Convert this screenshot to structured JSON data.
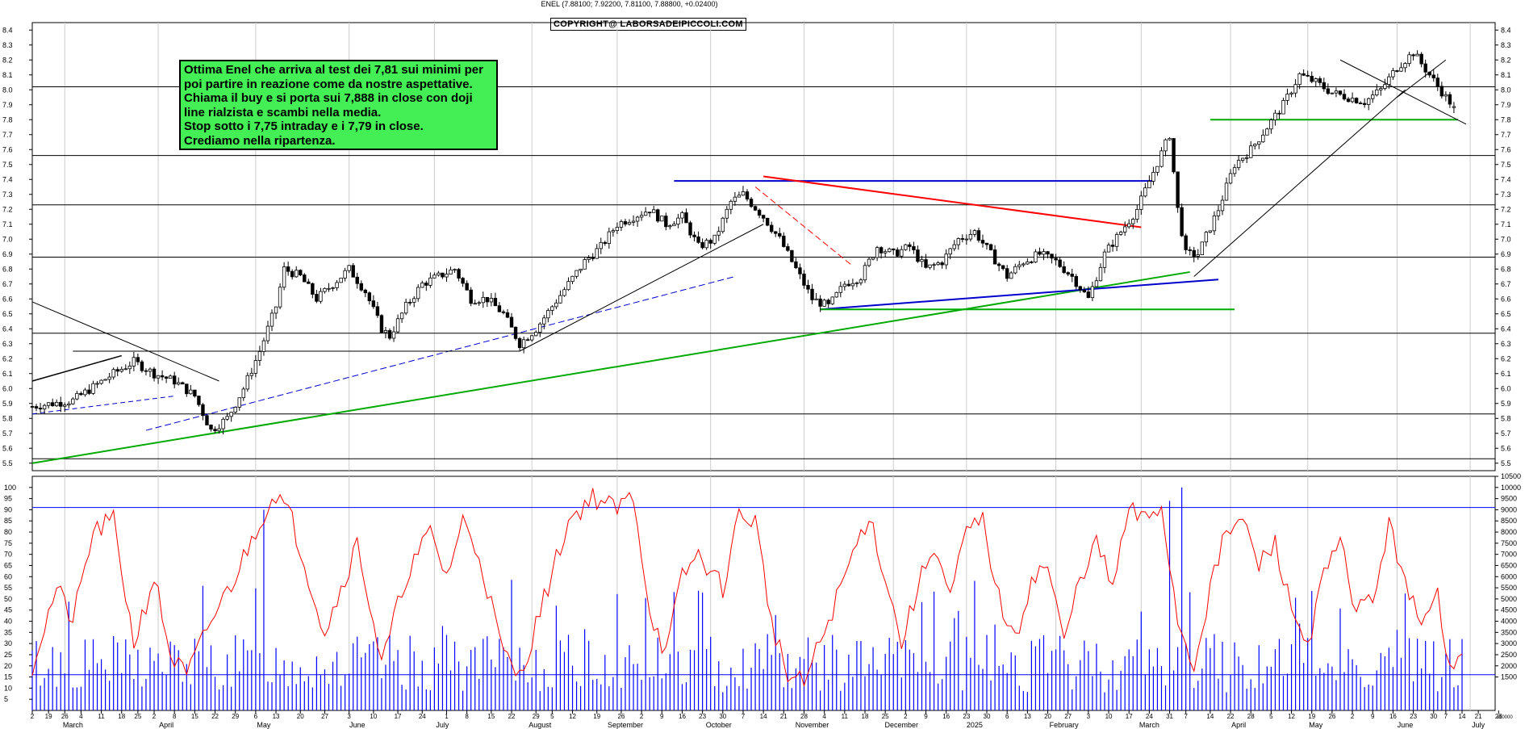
{
  "header": {
    "title": "ENEL (7.88100; 7.92200, 7.81100, 7.88800, +0.02400)",
    "copyright": "COPYRIGHT@ LABORSADEIPICCOLI.COM"
  },
  "annotation": {
    "lines": [
      "Ottima Enel che arriva al test dei 7,81 sui minimi per",
      "poi partire in reazione come da nostre aspettative.",
      "Chiama il buy e si porta sui 7,888 in close con doji",
      "line rialzista e scambi nella media.",
      "Stop sotto i 7,75 intraday e i 7,79 in close.",
      "Crediamo nella ripartenza."
    ]
  },
  "colors": {
    "candle_body": "#000000",
    "oscillator": "#ff0000",
    "volume": "#0000ff",
    "support_line": "#00aa00",
    "trend_blue": "#0000cc",
    "trend_red": "#ff0000",
    "annotation_bg": "#44ee55"
  },
  "chart_data": [
    {
      "type": "candlestick",
      "title": "ENEL daily",
      "ylim": [
        5.45,
        8.45
      ],
      "y_ticks": [
        5.5,
        5.6,
        5.7,
        5.8,
        5.9,
        6.0,
        6.1,
        6.2,
        6.3,
        6.4,
        6.5,
        6.6,
        6.7,
        6.8,
        6.9,
        7.0,
        7.1,
        7.2,
        7.3,
        7.4,
        7.5,
        7.6,
        7.7,
        7.8,
        7.9,
        8.0,
        8.1,
        8.2,
        8.3,
        8.4
      ],
      "y_tick_labels": [
        "5.5",
        "5.6",
        "5.7",
        "5.8",
        "5.9",
        "6.0",
        "6.1",
        "6.2",
        "6.3",
        "6.4",
        "6.5",
        "6.6",
        "6.7",
        "6.8",
        "6.9",
        "7.0",
        "7.1",
        "7.2",
        "7.3",
        "7.4",
        "7.5",
        "7.6",
        "7.7",
        "7.8",
        "7.9",
        "8.0",
        "8.1",
        "8.2",
        "8.3",
        "8.4"
      ],
      "horizontal_levels": [
        5.53,
        5.83,
        6.37,
        6.88,
        7.23,
        7.56,
        8.02
      ],
      "close_path": [
        {
          "d": 0,
          "v": 5.88
        },
        {
          "d": 10,
          "v": 5.92
        },
        {
          "d": 20,
          "v": 6.1
        },
        {
          "d": 25,
          "v": 6.18
        },
        {
          "d": 30,
          "v": 6.1
        },
        {
          "d": 35,
          "v": 6.05
        },
        {
          "d": 40,
          "v": 5.95
        },
        {
          "d": 44,
          "v": 5.72
        },
        {
          "d": 48,
          "v": 5.8
        },
        {
          "d": 52,
          "v": 6.0
        },
        {
          "d": 56,
          "v": 6.25
        },
        {
          "d": 60,
          "v": 6.55
        },
        {
          "d": 62,
          "v": 6.8
        },
        {
          "d": 66,
          "v": 6.75
        },
        {
          "d": 70,
          "v": 6.6
        },
        {
          "d": 74,
          "v": 6.7
        },
        {
          "d": 78,
          "v": 6.8
        },
        {
          "d": 82,
          "v": 6.65
        },
        {
          "d": 86,
          "v": 6.4
        },
        {
          "d": 88,
          "v": 6.35
        },
        {
          "d": 92,
          "v": 6.55
        },
        {
          "d": 96,
          "v": 6.7
        },
        {
          "d": 100,
          "v": 6.75
        },
        {
          "d": 104,
          "v": 6.8
        },
        {
          "d": 108,
          "v": 6.6
        },
        {
          "d": 112,
          "v": 6.6
        },
        {
          "d": 116,
          "v": 6.5
        },
        {
          "d": 120,
          "v": 6.3
        },
        {
          "d": 124,
          "v": 6.4
        },
        {
          "d": 128,
          "v": 6.55
        },
        {
          "d": 132,
          "v": 6.7
        },
        {
          "d": 136,
          "v": 6.85
        },
        {
          "d": 140,
          "v": 6.95
        },
        {
          "d": 144,
          "v": 7.1
        },
        {
          "d": 148,
          "v": 7.15
        },
        {
          "d": 152,
          "v": 7.2
        },
        {
          "d": 156,
          "v": 7.1
        },
        {
          "d": 160,
          "v": 7.15
        },
        {
          "d": 164,
          "v": 6.95
        },
        {
          "d": 168,
          "v": 7.0
        },
        {
          "d": 172,
          "v": 7.25
        },
        {
          "d": 175,
          "v": 7.3
        },
        {
          "d": 180,
          "v": 7.15
        },
        {
          "d": 184,
          "v": 7.0
        },
        {
          "d": 188,
          "v": 6.8
        },
        {
          "d": 192,
          "v": 6.6
        },
        {
          "d": 196,
          "v": 6.55
        },
        {
          "d": 200,
          "v": 6.7
        },
        {
          "d": 204,
          "v": 6.75
        },
        {
          "d": 208,
          "v": 6.95
        },
        {
          "d": 212,
          "v": 6.9
        },
        {
          "d": 216,
          "v": 6.95
        },
        {
          "d": 220,
          "v": 6.8
        },
        {
          "d": 224,
          "v": 6.85
        },
        {
          "d": 228,
          "v": 7.0
        },
        {
          "d": 232,
          "v": 7.05
        },
        {
          "d": 236,
          "v": 6.9
        },
        {
          "d": 240,
          "v": 6.75
        },
        {
          "d": 244,
          "v": 6.85
        },
        {
          "d": 248,
          "v": 6.9
        },
        {
          "d": 252,
          "v": 6.85
        },
        {
          "d": 256,
          "v": 6.75
        },
        {
          "d": 260,
          "v": 6.6
        },
        {
          "d": 264,
          "v": 6.9
        },
        {
          "d": 268,
          "v": 7.05
        },
        {
          "d": 272,
          "v": 7.2
        },
        {
          "d": 276,
          "v": 7.45
        },
        {
          "d": 280,
          "v": 7.7
        },
        {
          "d": 282,
          "v": 7.2
        },
        {
          "d": 284,
          "v": 6.9
        },
        {
          "d": 287,
          "v": 6.9
        },
        {
          "d": 292,
          "v": 7.2
        },
        {
          "d": 296,
          "v": 7.5
        },
        {
          "d": 300,
          "v": 7.6
        },
        {
          "d": 304,
          "v": 7.75
        },
        {
          "d": 308,
          "v": 7.9
        },
        {
          "d": 312,
          "v": 8.1
        },
        {
          "d": 316,
          "v": 8.05
        },
        {
          "d": 320,
          "v": 7.98
        },
        {
          "d": 324,
          "v": 7.95
        },
        {
          "d": 328,
          "v": 7.92
        },
        {
          "d": 332,
          "v": 8.0
        },
        {
          "d": 336,
          "v": 8.15
        },
        {
          "d": 340,
          "v": 8.25
        },
        {
          "d": 344,
          "v": 8.1
        },
        {
          "d": 348,
          "v": 7.95
        },
        {
          "d": 350,
          "v": 7.888
        }
      ],
      "trendlines": [
        {
          "color": "support_line",
          "from": [
            0,
            5.5
          ],
          "to": [
            285,
            6.78
          ]
        },
        {
          "color": "trend_blue",
          "from": [
            194,
            6.53
          ],
          "to": [
            292,
            6.73
          ]
        },
        {
          "color": "trend_blue",
          "from": [
            158,
            7.39
          ],
          "to": [
            276,
            7.39
          ]
        },
        {
          "color": "trend_red",
          "from": [
            180,
            7.42
          ],
          "to": [
            273,
            7.08
          ]
        },
        {
          "color": "support_line",
          "from": [
            290,
            7.8
          ],
          "to": [
            351,
            7.8
          ]
        },
        {
          "color": "support_line",
          "from": [
            194,
            6.53
          ],
          "to": [
            296,
            6.53
          ]
        }
      ]
    },
    {
      "type": "line",
      "ylim": [
        0,
        105
      ],
      "y_ticks": [
        5,
        10,
        15,
        20,
        25,
        30,
        35,
        40,
        45,
        50,
        55,
        60,
        65,
        70,
        75,
        80,
        85,
        90,
        95,
        100
      ],
      "y_tick_labels": [
        "5",
        "10",
        "15",
        "20",
        "25",
        "30",
        "35",
        "40",
        "45",
        "50",
        "55",
        "60",
        "65",
        "70",
        "75",
        "80",
        "85",
        "90",
        "95",
        "100"
      ],
      "levels": [
        16,
        91
      ],
      "oscillator_path": [
        {
          "d": 0,
          "v": 20
        },
        {
          "d": 6,
          "v": 55
        },
        {
          "d": 10,
          "v": 40
        },
        {
          "d": 15,
          "v": 80
        },
        {
          "d": 20,
          "v": 85
        },
        {
          "d": 25,
          "v": 30
        },
        {
          "d": 30,
          "v": 60
        },
        {
          "d": 34,
          "v": 25
        },
        {
          "d": 38,
          "v": 15
        },
        {
          "d": 44,
          "v": 40
        },
        {
          "d": 50,
          "v": 60
        },
        {
          "d": 56,
          "v": 85
        },
        {
          "d": 60,
          "v": 98
        },
        {
          "d": 64,
          "v": 85
        },
        {
          "d": 68,
          "v": 60
        },
        {
          "d": 72,
          "v": 35
        },
        {
          "d": 76,
          "v": 55
        },
        {
          "d": 80,
          "v": 75
        },
        {
          "d": 84,
          "v": 40
        },
        {
          "d": 86,
          "v": 20
        },
        {
          "d": 92,
          "v": 60
        },
        {
          "d": 98,
          "v": 80
        },
        {
          "d": 102,
          "v": 60
        },
        {
          "d": 106,
          "v": 85
        },
        {
          "d": 110,
          "v": 70
        },
        {
          "d": 116,
          "v": 25
        },
        {
          "d": 120,
          "v": 15
        },
        {
          "d": 126,
          "v": 50
        },
        {
          "d": 132,
          "v": 85
        },
        {
          "d": 138,
          "v": 96
        },
        {
          "d": 144,
          "v": 90
        },
        {
          "d": 148,
          "v": 97
        },
        {
          "d": 152,
          "v": 45
        },
        {
          "d": 156,
          "v": 25
        },
        {
          "d": 160,
          "v": 60
        },
        {
          "d": 164,
          "v": 70
        },
        {
          "d": 170,
          "v": 55
        },
        {
          "d": 174,
          "v": 88
        },
        {
          "d": 178,
          "v": 85
        },
        {
          "d": 182,
          "v": 40
        },
        {
          "d": 186,
          "v": 15
        },
        {
          "d": 190,
          "v": 12
        },
        {
          "d": 196,
          "v": 40
        },
        {
          "d": 202,
          "v": 70
        },
        {
          "d": 206,
          "v": 88
        },
        {
          "d": 210,
          "v": 60
        },
        {
          "d": 214,
          "v": 30
        },
        {
          "d": 218,
          "v": 55
        },
        {
          "d": 222,
          "v": 75
        },
        {
          "d": 226,
          "v": 50
        },
        {
          "d": 230,
          "v": 80
        },
        {
          "d": 234,
          "v": 85
        },
        {
          "d": 238,
          "v": 50
        },
        {
          "d": 242,
          "v": 30
        },
        {
          "d": 246,
          "v": 60
        },
        {
          "d": 250,
          "v": 65
        },
        {
          "d": 254,
          "v": 30
        },
        {
          "d": 258,
          "v": 60
        },
        {
          "d": 262,
          "v": 75
        },
        {
          "d": 266,
          "v": 55
        },
        {
          "d": 270,
          "v": 90
        },
        {
          "d": 274,
          "v": 85
        },
        {
          "d": 278,
          "v": 92
        },
        {
          "d": 282,
          "v": 40
        },
        {
          "d": 286,
          "v": 20
        },
        {
          "d": 290,
          "v": 55
        },
        {
          "d": 294,
          "v": 80
        },
        {
          "d": 298,
          "v": 85
        },
        {
          "d": 302,
          "v": 65
        },
        {
          "d": 306,
          "v": 75
        },
        {
          "d": 310,
          "v": 45
        },
        {
          "d": 314,
          "v": 30
        },
        {
          "d": 318,
          "v": 60
        },
        {
          "d": 322,
          "v": 75
        },
        {
          "d": 326,
          "v": 45
        },
        {
          "d": 330,
          "v": 50
        },
        {
          "d": 334,
          "v": 82
        },
        {
          "d": 338,
          "v": 60
        },
        {
          "d": 342,
          "v": 35
        },
        {
          "d": 346,
          "v": 52
        },
        {
          "d": 348,
          "v": 30
        },
        {
          "d": 350,
          "v": 20
        },
        {
          "d": 352,
          "v": 30
        }
      ],
      "volume_ylim": [
        0,
        10500
      ],
      "volume_ticks": [
        1500,
        2000,
        2500,
        3000,
        3500,
        4000,
        4500,
        5000,
        5500,
        6000,
        6500,
        7000,
        7500,
        8000,
        8500,
        9000,
        9500,
        10000,
        10500
      ],
      "volume_tick_labels": [
        "1500",
        "2000",
        "2500",
        "3000",
        "3500",
        "4000",
        "4500",
        "5000",
        "5500",
        "6000",
        "6500",
        "7000",
        "7500",
        "8000",
        "8500",
        "9000",
        "9500",
        "10000",
        "10500"
      ],
      "volume_unit_label": "x10000",
      "volume_spikes": [
        {
          "d": 57,
          "v": 9000
        },
        {
          "d": 280,
          "v": 9400
        },
        {
          "d": 283,
          "v": 10000
        }
      ]
    }
  ],
  "x_axis": {
    "day_ticks": [
      {
        "d": 0,
        "t": "2"
      },
      {
        "d": 4,
        "t": "19"
      },
      {
        "d": 8,
        "t": "26"
      },
      {
        "d": 12,
        "t": "4"
      },
      {
        "d": 17,
        "t": "11"
      },
      {
        "d": 22,
        "t": "18"
      },
      {
        "d": 26,
        "t": "25"
      },
      {
        "d": 30,
        "t": "2"
      },
      {
        "d": 35,
        "t": "8"
      },
      {
        "d": 40,
        "t": "15"
      },
      {
        "d": 45,
        "t": "22"
      },
      {
        "d": 50,
        "t": "29"
      },
      {
        "d": 55,
        "t": "6"
      },
      {
        "d": 60,
        "t": "13"
      },
      {
        "d": 66,
        "t": "20"
      },
      {
        "d": 72,
        "t": "27"
      },
      {
        "d": 78,
        "t": "3"
      },
      {
        "d": 84,
        "t": "10"
      },
      {
        "d": 90,
        "t": "17"
      },
      {
        "d": 96,
        "t": "24"
      },
      {
        "d": 102,
        "t": "1"
      },
      {
        "d": 107,
        "t": "8"
      },
      {
        "d": 113,
        "t": "15"
      },
      {
        "d": 118,
        "t": "22"
      },
      {
        "d": 124,
        "t": "29"
      },
      {
        "d": 128,
        "t": "5"
      },
      {
        "d": 133,
        "t": "12"
      },
      {
        "d": 139,
        "t": "19"
      },
      {
        "d": 145,
        "t": "26"
      },
      {
        "d": 150,
        "t": "2"
      },
      {
        "d": 155,
        "t": "9"
      },
      {
        "d": 160,
        "t": "16"
      },
      {
        "d": 165,
        "t": "23"
      },
      {
        "d": 170,
        "t": "30"
      },
      {
        "d": 175,
        "t": "7"
      },
      {
        "d": 180,
        "t": "14"
      },
      {
        "d": 185,
        "t": "21"
      },
      {
        "d": 190,
        "t": "28"
      },
      {
        "d": 195,
        "t": "4"
      },
      {
        "d": 200,
        "t": "11"
      },
      {
        "d": 205,
        "t": "18"
      },
      {
        "d": 210,
        "t": "25"
      },
      {
        "d": 215,
        "t": "2"
      },
      {
        "d": 220,
        "t": "9"
      },
      {
        "d": 225,
        "t": "16"
      },
      {
        "d": 230,
        "t": "23"
      },
      {
        "d": 235,
        "t": "30"
      },
      {
        "d": 240,
        "t": "6"
      },
      {
        "d": 245,
        "t": "13"
      },
      {
        "d": 250,
        "t": "20"
      },
      {
        "d": 255,
        "t": "27"
      },
      {
        "d": 260,
        "t": "3"
      },
      {
        "d": 265,
        "t": "10"
      },
      {
        "d": 270,
        "t": "17"
      },
      {
        "d": 275,
        "t": "24"
      },
      {
        "d": 280,
        "t": "31"
      },
      {
        "d": 284,
        "t": "7"
      },
      {
        "d": 290,
        "t": "14"
      },
      {
        "d": 295,
        "t": "22"
      },
      {
        "d": 300,
        "t": "28"
      },
      {
        "d": 305,
        "t": "5"
      },
      {
        "d": 310,
        "t": "12"
      },
      {
        "d": 315,
        "t": "19"
      },
      {
        "d": 320,
        "t": "26"
      },
      {
        "d": 325,
        "t": "2"
      },
      {
        "d": 330,
        "t": "9"
      },
      {
        "d": 335,
        "t": "16"
      },
      {
        "d": 340,
        "t": "23"
      },
      {
        "d": 345,
        "t": "30"
      },
      {
        "d": 348,
        "t": "7"
      },
      {
        "d": 352,
        "t": "14"
      },
      {
        "d": 356,
        "t": "21"
      },
      {
        "d": 361,
        "t": "28"
      }
    ],
    "months": [
      {
        "d": 10,
        "t": "March"
      },
      {
        "d": 33,
        "t": "April"
      },
      {
        "d": 57,
        "t": "May"
      },
      {
        "d": 80,
        "t": "June"
      },
      {
        "d": 101,
        "t": "July"
      },
      {
        "d": 125,
        "t": "August"
      },
      {
        "d": 146,
        "t": "September"
      },
      {
        "d": 169,
        "t": "October"
      },
      {
        "d": 192,
        "t": "November"
      },
      {
        "d": 214,
        "t": "December"
      },
      {
        "d": 232,
        "t": "2025"
      },
      {
        "d": 254,
        "t": "February"
      },
      {
        "d": 275,
        "t": "March"
      },
      {
        "d": 297,
        "t": "April"
      },
      {
        "d": 316,
        "t": "May"
      },
      {
        "d": 338,
        "t": "June"
      },
      {
        "d": 356,
        "t": "July"
      }
    ]
  }
}
